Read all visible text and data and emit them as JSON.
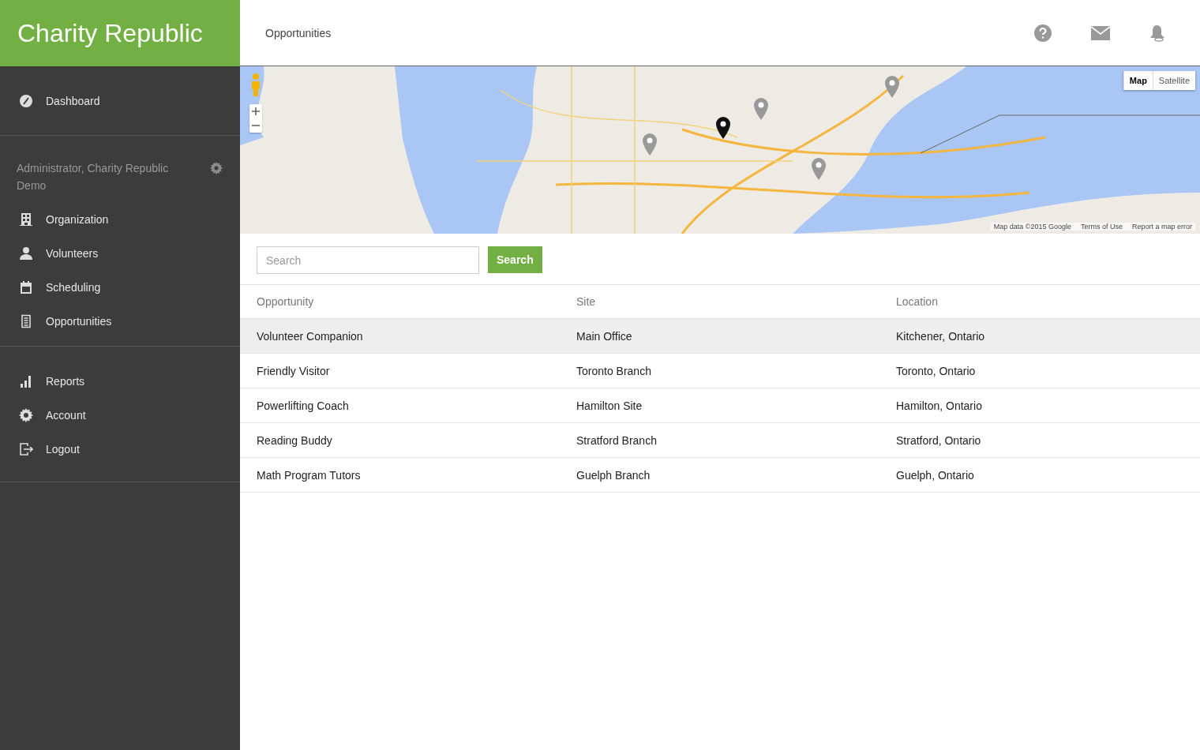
{
  "brand": "Charity Republic",
  "header": {
    "title": "Opportunities"
  },
  "sidebar": {
    "sections": [
      {
        "items": [
          {
            "label": "Dashboard",
            "kind": "dashboard"
          }
        ]
      },
      {
        "user": "Administrator, Charity Republic Demo",
        "items": [
          {
            "label": "Organization",
            "kind": "building"
          },
          {
            "label": "Volunteers",
            "kind": "person"
          },
          {
            "label": "Scheduling",
            "kind": "calendar"
          },
          {
            "label": "Opportunities",
            "kind": "list"
          }
        ]
      },
      {
        "items": [
          {
            "label": "Reports",
            "kind": "chart"
          },
          {
            "label": "Account",
            "kind": "gear"
          },
          {
            "label": "Logout",
            "kind": "logout"
          }
        ]
      }
    ]
  },
  "map": {
    "types": [
      {
        "label": "Map",
        "selected": true
      },
      {
        "label": "Satellite",
        "selected": false
      }
    ],
    "attribution": [
      "Map data ©2015 Google",
      "Terms of Use",
      "Report a map error"
    ]
  },
  "search": {
    "placeholder": "Search",
    "button": "Search"
  },
  "table": {
    "columns": [
      "Opportunity",
      "Site",
      "Location"
    ],
    "rows": [
      {
        "selected": true,
        "cells": [
          "Volunteer Companion",
          "Main Office",
          "Kitchener, Ontario"
        ]
      },
      {
        "selected": false,
        "cells": [
          "Friendly Visitor",
          "Toronto Branch",
          "Toronto, Ontario"
        ]
      },
      {
        "selected": false,
        "cells": [
          "Powerlifting Coach",
          "Hamilton Site",
          "Hamilton, Ontario"
        ]
      },
      {
        "selected": false,
        "cells": [
          "Reading Buddy",
          "Stratford Branch",
          "Stratford, Ontario"
        ]
      },
      {
        "selected": false,
        "cells": [
          "Math Program Tutors",
          "Guelph Branch",
          "Guelph, Ontario"
        ]
      }
    ]
  }
}
